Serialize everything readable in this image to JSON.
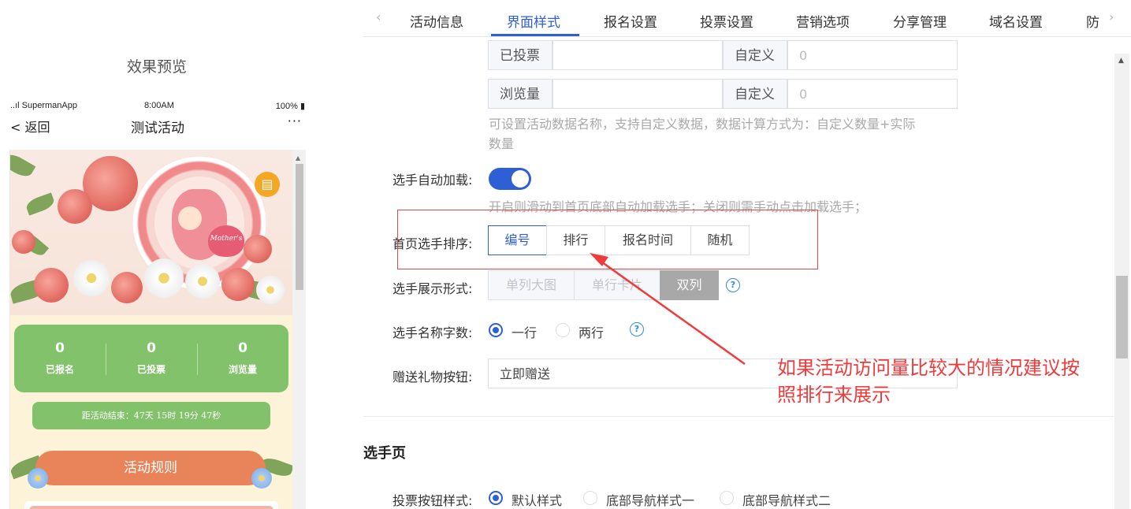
{
  "preview": {
    "title": "效果预览",
    "status": {
      "carrier": "..ıl SupermanApp",
      "time": "8:00AM",
      "battery": "100%"
    },
    "nav": {
      "back": "返回",
      "title": "测试活动",
      "more": "···"
    },
    "banner": {
      "heart_text": "Mother's"
    },
    "stats": [
      {
        "value": "0",
        "label": "已报名"
      },
      {
        "value": "0",
        "label": "已投票"
      },
      {
        "value": "0",
        "label": "浏览量"
      }
    ],
    "countdown": "距活动结束：47天 15时 19分 47秒",
    "rules_button": "活动规则"
  },
  "tabs": {
    "items": [
      {
        "label": "活动信息"
      },
      {
        "label": "界面样式"
      },
      {
        "label": "报名设置"
      },
      {
        "label": "投票设置"
      },
      {
        "label": "营销选项"
      },
      {
        "label": "分享管理"
      },
      {
        "label": "域名设置"
      },
      {
        "label": "防"
      }
    ],
    "active_index": 1,
    "prev_icon": "‹",
    "next_icon": "›"
  },
  "data_rows": [
    {
      "name_label": "已投票",
      "custom_label": "自定义",
      "custom_value": "0"
    },
    {
      "name_label": "浏览量",
      "custom_label": "自定义",
      "custom_value": "0"
    }
  ],
  "data_hint": [
    "可设置活动数据名称，支持自定义数据，数据计算方式为：自定义数量+实际",
    "数量"
  ],
  "auto_load": {
    "label": "选手自动加载:",
    "enabled": true,
    "hint": "开启则滑动到首页底部自动加载选手；关闭则需手动点击加载选手；"
  },
  "sort": {
    "label": "首页选手排序:",
    "options": [
      "编号",
      "排行",
      "报名时间",
      "随机"
    ],
    "selected": "编号"
  },
  "display": {
    "label": "选手展示形式:",
    "options": [
      "单列大图",
      "单行卡片",
      "双列"
    ],
    "selected": "双列"
  },
  "name_lines": {
    "label": "选手名称字数:",
    "options": [
      "一行",
      "两行"
    ],
    "selected": "一行"
  },
  "gift_button": {
    "label": "赠送礼物按钮:",
    "value": "立即赠送"
  },
  "player_page": {
    "title": "选手页",
    "vote_style": {
      "label": "投票按钮样式:",
      "options": [
        "默认样式",
        "底部导航样式一",
        "底部导航样式二"
      ],
      "selected": "默认样式"
    }
  },
  "annotation": {
    "text_line1": "如果活动访问量比较大的情况建议按",
    "text_line2": "照排行来展示",
    "color": "#ef3b3b"
  },
  "colors": {
    "primary": "#2f5fd4",
    "stat_green": "#82c26a",
    "rules_orange": "#e8835a"
  }
}
